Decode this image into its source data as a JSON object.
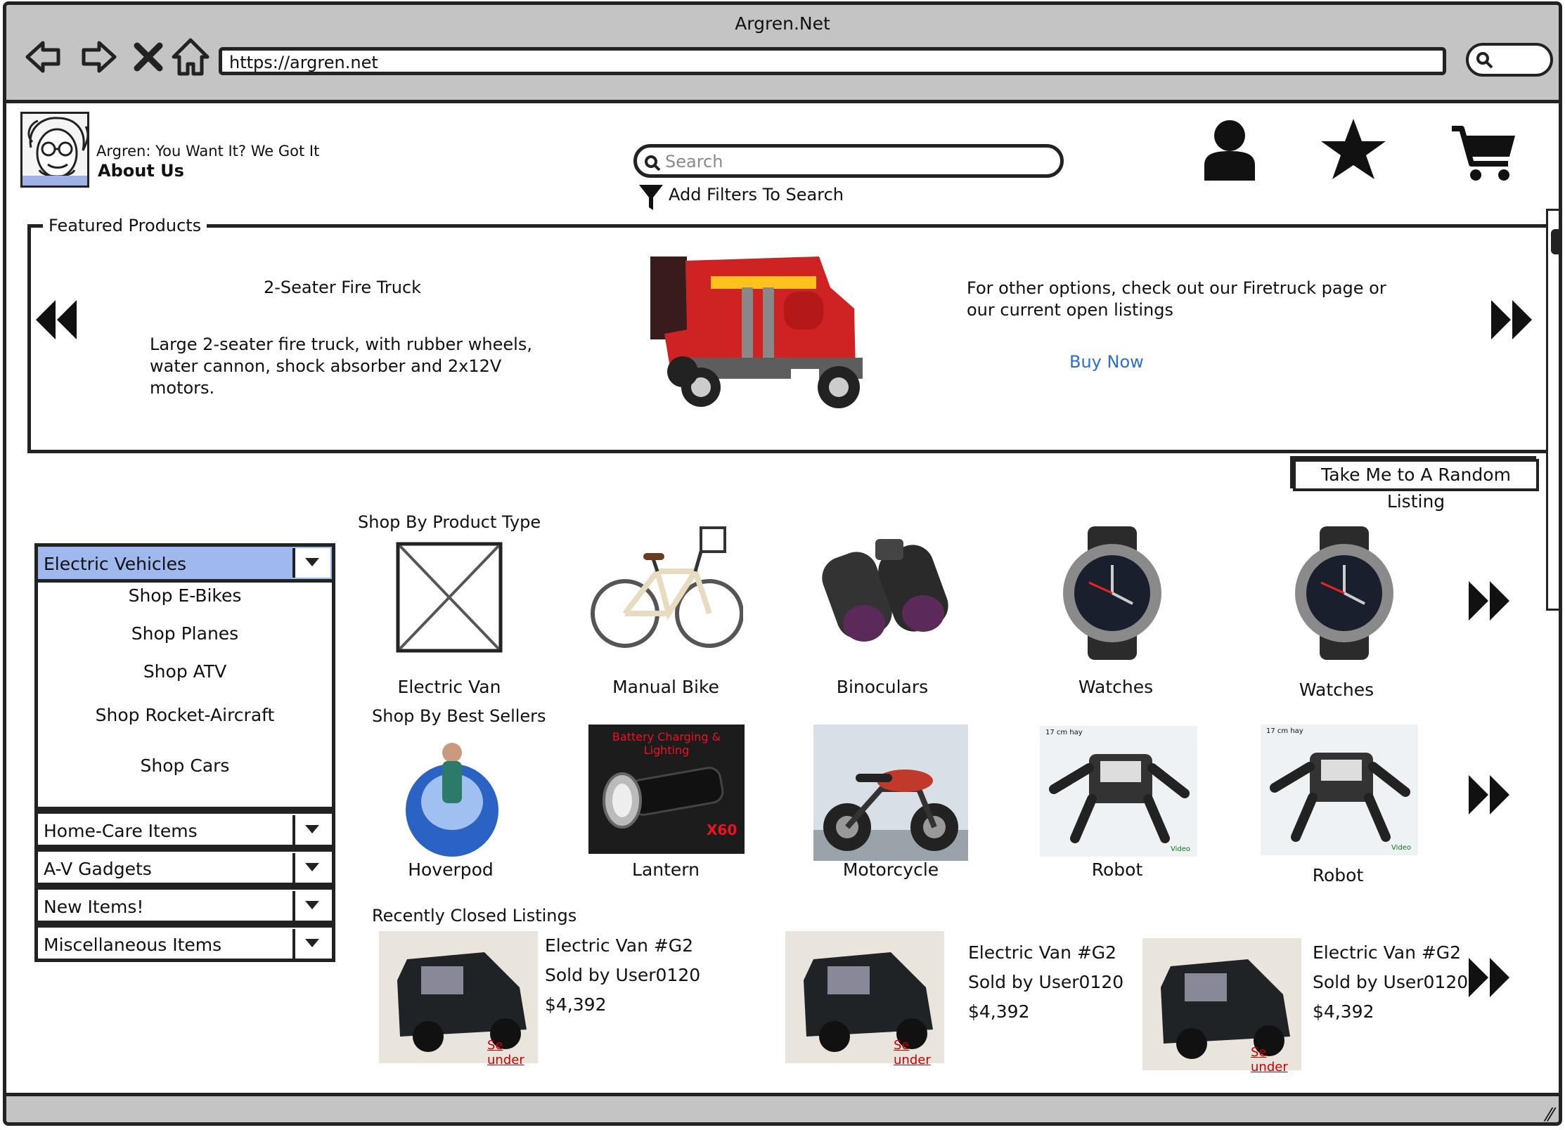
{
  "window": {
    "title": "Argren.Net",
    "url": "https://argren.net"
  },
  "header": {
    "tagline": "Argren: You Want It? We Got It",
    "about": "About Us",
    "search_placeholder": "Search",
    "filters": "Add Filters To Search"
  },
  "featured": {
    "legend": "Featured Products",
    "product_title": "2-Seater Fire Truck",
    "description": "Large 2-seater fire truck, with rubber wheels, water cannon, shock absorber and 2x12V motors.",
    "other_options": "For other options, check out our Firetruck page or our current open listings",
    "buy_now": "Buy Now"
  },
  "random_listing": "Take Me to A Random Listing",
  "categories": {
    "selected": "Electric Vehicles",
    "sub_items": [
      "Shop E-Bikes",
      "Shop Planes",
      "Shop ATV",
      "Shop Rocket-Aircraft",
      "Shop Cars"
    ],
    "others": [
      "Home-Care Items",
      "A-V Gadgets",
      "New Items!",
      "Miscellaneous Items"
    ]
  },
  "product_types": {
    "label": "Shop By Product Type",
    "items": [
      "Electric Van",
      "Manual Bike",
      "Binoculars",
      "Watches",
      "Watches"
    ]
  },
  "best_sellers": {
    "label": "Shop By Best Sellers",
    "items": [
      "Hoverpod",
      "Lantern",
      "Motorcycle",
      "Robot",
      "Robot"
    ],
    "lantern_banner": "Battery Charging & Lighting",
    "robot_caption": "17 cm hay",
    "robot_video": "Video",
    "lantern_model": "X60"
  },
  "closed": {
    "label": "Recently Closed Listings",
    "items": [
      {
        "name": "Electric Van #G2",
        "seller": "Sold by User0120",
        "price": "$4,392",
        "overlay": "Se under"
      },
      {
        "name": "Electric Van #G2",
        "seller": "Sold by User0120",
        "price": "$4,392",
        "overlay": "Se under"
      },
      {
        "name": "Electric Van #G2",
        "seller": "Sold by User0120",
        "price": "$4,392",
        "overlay": "Se under"
      }
    ]
  },
  "colors": {
    "selected_category": "#9fb8ee",
    "link": "#2a6fd1",
    "chrome": "#c4c4c4"
  }
}
